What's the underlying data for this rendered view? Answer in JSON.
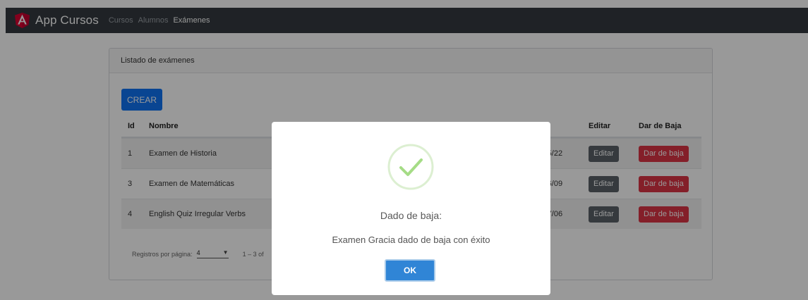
{
  "navbar": {
    "brand": "App Cursos",
    "links": [
      "Cursos",
      "Alumnos",
      "Exámenes"
    ],
    "active_index": 2
  },
  "card": {
    "header": "Listado de exámenes",
    "create_label": "CREAR"
  },
  "table": {
    "headers": [
      "Id",
      "Nombre",
      "Editar",
      "Dar de Baja"
    ],
    "rows": [
      {
        "id": "1",
        "name": "Examen de Historia",
        "date_fragment": ")5/22",
        "edit": "Editar",
        "delete": "Dar de baja"
      },
      {
        "id": "3",
        "name": "Examen de Matemáticas",
        "date_fragment": ")6/09",
        "edit": "Editar",
        "delete": "Dar de baja"
      },
      {
        "id": "4",
        "name": "English Quiz Irregular Verbs",
        "date_fragment": ")7/06",
        "edit": "Editar",
        "delete": "Dar de baja"
      }
    ]
  },
  "paginator": {
    "label": "Registros por página:",
    "page_size": "4",
    "range": "1 – 3 of"
  },
  "modal": {
    "title": "Dado de baja:",
    "text": "Examen Gracia dado de baja con éxito",
    "ok_label": "OK"
  },
  "colors": {
    "navbar": "#343a40",
    "primary": "#0f74f4",
    "danger": "#dc3545",
    "secondary": "#5a6268",
    "ok": "#3085d6",
    "success": "#a5dc86"
  }
}
